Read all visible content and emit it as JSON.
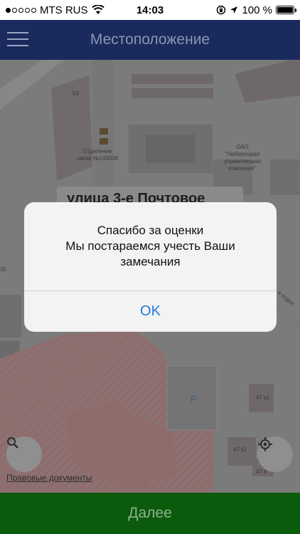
{
  "status_bar": {
    "carrier": "MTS RUS",
    "time": "14:03",
    "battery": "100 %",
    "battery_level": 1.0
  },
  "nav": {
    "title": "Местоположение"
  },
  "map": {
    "street_name": "улица 3-е Почтовое",
    "labels": {
      "building_54": "54",
      "post_office_line1": "Отделение",
      "post_office_line2": "связи №140008",
      "company_line1": "ОАО",
      "company_line2": "\"Люберецкая",
      "company_line3": "управляющая",
      "company_line4": "компания\"",
      "building_35": "35",
      "street_side": "е отдел",
      "parking": "P",
      "building_47k1": "47 к1",
      "building_47k2": "47 к2",
      "building_47k_2": "47 к"
    },
    "legal_link": "Правовые документы"
  },
  "alert": {
    "line1": "Спасибо за оценки",
    "line2": "Мы постараемся учесть Ваши",
    "line3": "замечания",
    "ok_label": "OK"
  },
  "bottom": {
    "next_label": "Далее"
  }
}
